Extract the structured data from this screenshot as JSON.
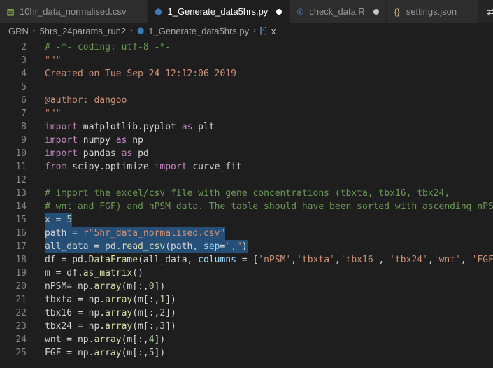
{
  "tabs": [
    {
      "label": "10hr_data_normalised.csv",
      "icon": "table-icon",
      "active": false,
      "dirty": false
    },
    {
      "label": "1_Generate_data5hrs.py",
      "icon": "python-icon",
      "active": true,
      "dirty": true
    },
    {
      "label": "check_data.R",
      "icon": "r-icon",
      "active": false,
      "dirty": true
    },
    {
      "label": "settings.json",
      "icon": "json-icon",
      "active": false,
      "dirty": false
    }
  ],
  "breadcrumb": {
    "items": [
      "GRN",
      "5hrs_24params_run2",
      "1_Generate_data5hrs.py",
      "x"
    ]
  },
  "code": {
    "lines": [
      {
        "n": "2",
        "tokens": [
          [
            "com",
            "# -*- coding: utf-8 -*-"
          ]
        ]
      },
      {
        "n": "3",
        "tokens": [
          [
            "str",
            "\"\"\""
          ]
        ]
      },
      {
        "n": "4",
        "tokens": [
          [
            "str",
            "Created on Tue Sep 24 12:12:06 2019"
          ]
        ]
      },
      {
        "n": "5",
        "tokens": []
      },
      {
        "n": "6",
        "tokens": [
          [
            "str",
            "@author: dangoo"
          ]
        ]
      },
      {
        "n": "7",
        "tokens": [
          [
            "str",
            "\"\"\""
          ]
        ]
      },
      {
        "n": "8",
        "tokens": [
          [
            "kw",
            "import"
          ],
          [
            "id",
            " matplotlib.pyplot "
          ],
          [
            "kw",
            "as"
          ],
          [
            "id",
            " plt"
          ]
        ]
      },
      {
        "n": "9",
        "tokens": [
          [
            "kw",
            "import"
          ],
          [
            "id",
            " numpy "
          ],
          [
            "kw",
            "as"
          ],
          [
            "id",
            " np"
          ]
        ]
      },
      {
        "n": "10",
        "tokens": [
          [
            "kw",
            "import"
          ],
          [
            "id",
            " pandas "
          ],
          [
            "kw",
            "as"
          ],
          [
            "id",
            " pd"
          ]
        ]
      },
      {
        "n": "11",
        "tokens": [
          [
            "kw",
            "from"
          ],
          [
            "id",
            " scipy.optimize "
          ],
          [
            "kw",
            "import"
          ],
          [
            "id",
            " curve_fit"
          ]
        ]
      },
      {
        "n": "12",
        "tokens": []
      },
      {
        "n": "13",
        "tokens": [
          [
            "com",
            "# import the excel/csv file with gene concentrations (tbxta, tbx16, tbx24,"
          ]
        ]
      },
      {
        "n": "14",
        "tokens": [
          [
            "com",
            "# wnt and FGF) and nPSM data. The table should have been sorted with ascending nPSM"
          ]
        ]
      },
      {
        "n": "15",
        "selected": true,
        "tokens": [
          [
            "id",
            "x = "
          ],
          [
            "num",
            "5"
          ]
        ]
      },
      {
        "n": "16",
        "selected": true,
        "tokens": [
          [
            "id",
            "path = "
          ],
          [
            "str",
            "r\"5hr_data_normalised.csv\""
          ]
        ]
      },
      {
        "n": "17",
        "selected": true,
        "tokens": [
          [
            "id",
            "all_data = pd."
          ],
          [
            "fn",
            "read_csv"
          ],
          [
            "id",
            "(path, "
          ],
          [
            "prm",
            "sep"
          ],
          [
            "id",
            "="
          ],
          [
            "str",
            "\",\""
          ],
          [
            "id",
            ")"
          ]
        ]
      },
      {
        "n": "18",
        "tokens": [
          [
            "id",
            "df = pd."
          ],
          [
            "fn",
            "DataFrame"
          ],
          [
            "id",
            "(all_data, "
          ],
          [
            "prm",
            "columns"
          ],
          [
            "id",
            " = ["
          ],
          [
            "str",
            "'nPSM'"
          ],
          [
            "id",
            ","
          ],
          [
            "str",
            "'tbxta'"
          ],
          [
            "id",
            ","
          ],
          [
            "str",
            "'tbx16'"
          ],
          [
            "id",
            ", "
          ],
          [
            "str",
            "'tbx24'"
          ],
          [
            "id",
            ","
          ],
          [
            "str",
            "'wnt'"
          ],
          [
            "id",
            ", "
          ],
          [
            "str",
            "'FGF'"
          ]
        ]
      },
      {
        "n": "19",
        "tokens": [
          [
            "id",
            "m = df."
          ],
          [
            "fn",
            "as_matrix"
          ],
          [
            "id",
            "()"
          ]
        ]
      },
      {
        "n": "20",
        "tokens": [
          [
            "id",
            "nPSM= np."
          ],
          [
            "fn",
            "array"
          ],
          [
            "id",
            "(m[:,"
          ],
          [
            "num",
            "0"
          ],
          [
            "id",
            "])"
          ]
        ]
      },
      {
        "n": "21",
        "tokens": [
          [
            "id",
            "tbxta = np."
          ],
          [
            "fn",
            "array"
          ],
          [
            "id",
            "(m[:,"
          ],
          [
            "num",
            "1"
          ],
          [
            "id",
            "])"
          ]
        ]
      },
      {
        "n": "22",
        "tokens": [
          [
            "id",
            "tbx16 = np."
          ],
          [
            "fn",
            "array"
          ],
          [
            "id",
            "(m[:,"
          ],
          [
            "num",
            "2"
          ],
          [
            "id",
            "])"
          ]
        ]
      },
      {
        "n": "23",
        "tokens": [
          [
            "id",
            "tbx24 = np."
          ],
          [
            "fn",
            "array"
          ],
          [
            "id",
            "(m[:,"
          ],
          [
            "num",
            "3"
          ],
          [
            "id",
            "])"
          ]
        ]
      },
      {
        "n": "24",
        "tokens": [
          [
            "id",
            "wnt = np."
          ],
          [
            "fn",
            "array"
          ],
          [
            "id",
            "(m[:,"
          ],
          [
            "num",
            "4"
          ],
          [
            "id",
            "])"
          ]
        ]
      },
      {
        "n": "25",
        "tokens": [
          [
            "id",
            "FGF = np."
          ],
          [
            "fn",
            "array"
          ],
          [
            "id",
            "(m[:,"
          ],
          [
            "num",
            "5"
          ],
          [
            "id",
            "])"
          ]
        ]
      }
    ]
  },
  "colors": {
    "background": "#1e1e1e",
    "tab_inactive": "#2d2d2d",
    "selection": "#264f78",
    "keyword": "#c586c0",
    "string": "#ce9178",
    "comment": "#6a9955"
  }
}
